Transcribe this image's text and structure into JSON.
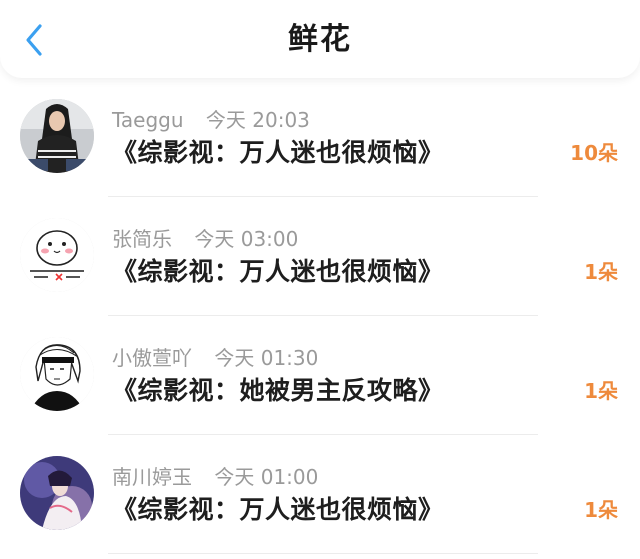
{
  "header": {
    "title": "鲜花",
    "back_icon": "chevron-left-icon",
    "accent_color": "#3ba0f0"
  },
  "gifts": [
    {
      "user": "Taeggu",
      "day": "今天",
      "time": "20:03",
      "book": "《综影视：万人迷也很烦恼》",
      "count": "10朵",
      "avatar": "avatar-photo-woman"
    },
    {
      "user": "张简乐",
      "day": "今天",
      "time": "03:00",
      "book": "《综影视：万人迷也很烦恼》",
      "count": "1朵",
      "avatar": "avatar-cartoon-blob"
    },
    {
      "user": "小傲萱吖",
      "day": "今天",
      "time": "01:30",
      "book": "《综影视：她被男主反攻略》",
      "count": "1朵",
      "avatar": "avatar-sketch-girl"
    },
    {
      "user": "南川婷玉",
      "day": "今天",
      "time": "01:00",
      "book": "《综影视：万人迷也很烦恼》",
      "count": "1朵",
      "avatar": "avatar-painting"
    }
  ],
  "colors": {
    "count": "#ee8a3c",
    "meta": "#9a9a9a",
    "title": "#1a1a1a"
  }
}
